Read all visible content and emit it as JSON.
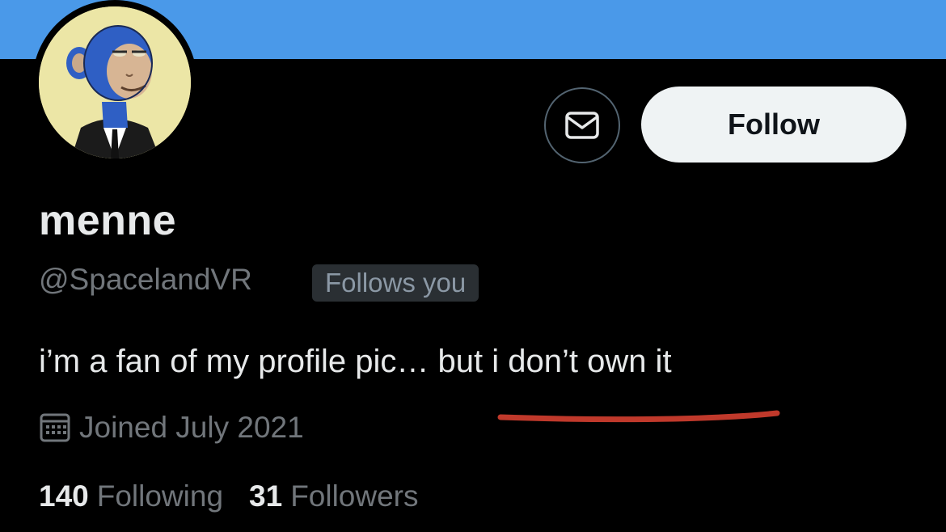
{
  "colors": {
    "banner": "#4a99e9",
    "background": "#000000",
    "primary_text": "#e7e9ea",
    "secondary_text": "#71767b",
    "follow_button_bg": "#eff3f4",
    "annotation_underline": "#c0392b"
  },
  "header": {
    "avatar_icon": "profile-picture-ape-avatar",
    "message_icon": "envelope-icon",
    "follow_label": "Follow"
  },
  "profile": {
    "display_name": "menne",
    "handle": "@SpacelandVR",
    "follows_you_label": "Follows you",
    "bio": "i’m a fan of my profile pic… but i don’t own it",
    "joined_icon": "calendar-icon",
    "joined_text": "Joined July 2021",
    "following_count": "140",
    "following_label": "Following",
    "followers_count": "31",
    "followers_label": "Followers"
  }
}
